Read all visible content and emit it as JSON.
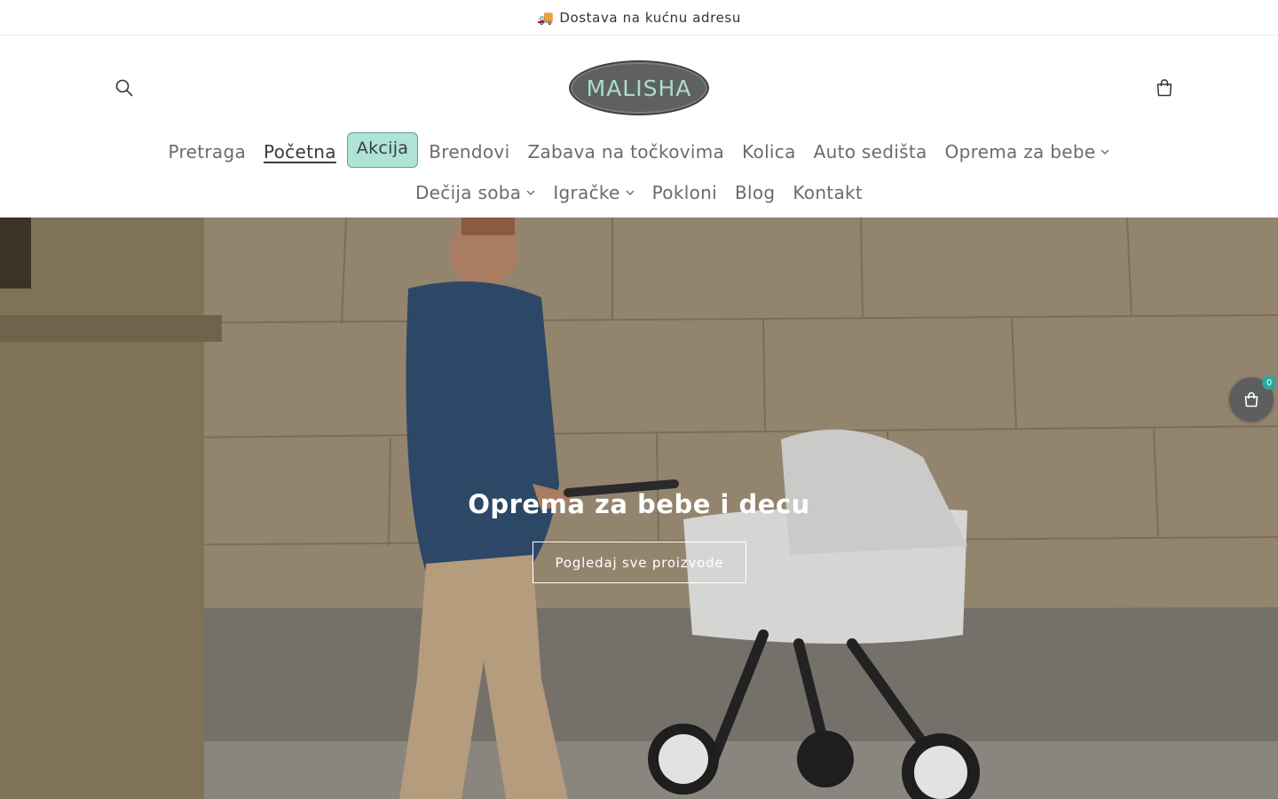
{
  "announcement": {
    "icon": "truck-icon",
    "icon_glyph": "🚚",
    "text": "Dostava na kućnu adresu"
  },
  "header": {
    "logo_text": "MALISHA",
    "search_icon": "search-icon",
    "cart_icon": "cart-icon"
  },
  "nav": {
    "row1": [
      {
        "label": "Pretraga",
        "dropdown": false
      },
      {
        "label": "Početna",
        "dropdown": false,
        "active": true
      },
      {
        "label": "Akcija",
        "dropdown": false,
        "highlight": true
      },
      {
        "label": "Brendovi",
        "dropdown": false
      },
      {
        "label": "Zabava na točkovima",
        "dropdown": false
      },
      {
        "label": "Kolica",
        "dropdown": false
      },
      {
        "label": "Auto sedišta",
        "dropdown": false
      },
      {
        "label": "Oprema za bebe",
        "dropdown": true
      }
    ],
    "row2": [
      {
        "label": "Dečija soba",
        "dropdown": true
      },
      {
        "label": "Igračke",
        "dropdown": true
      },
      {
        "label": "Pokloni",
        "dropdown": false
      },
      {
        "label": "Blog",
        "dropdown": false
      },
      {
        "label": "Kontakt",
        "dropdown": false
      }
    ]
  },
  "hero": {
    "title": "Oprema za bebe i decu",
    "button_label": "Pogledaj sve proizvode"
  },
  "floating_cart": {
    "count": "0",
    "icon": "shopping-bag-icon"
  },
  "colors": {
    "accent": "#aee3d6",
    "badge": "#2aa8a0",
    "logo_bg": "#5f615f"
  }
}
